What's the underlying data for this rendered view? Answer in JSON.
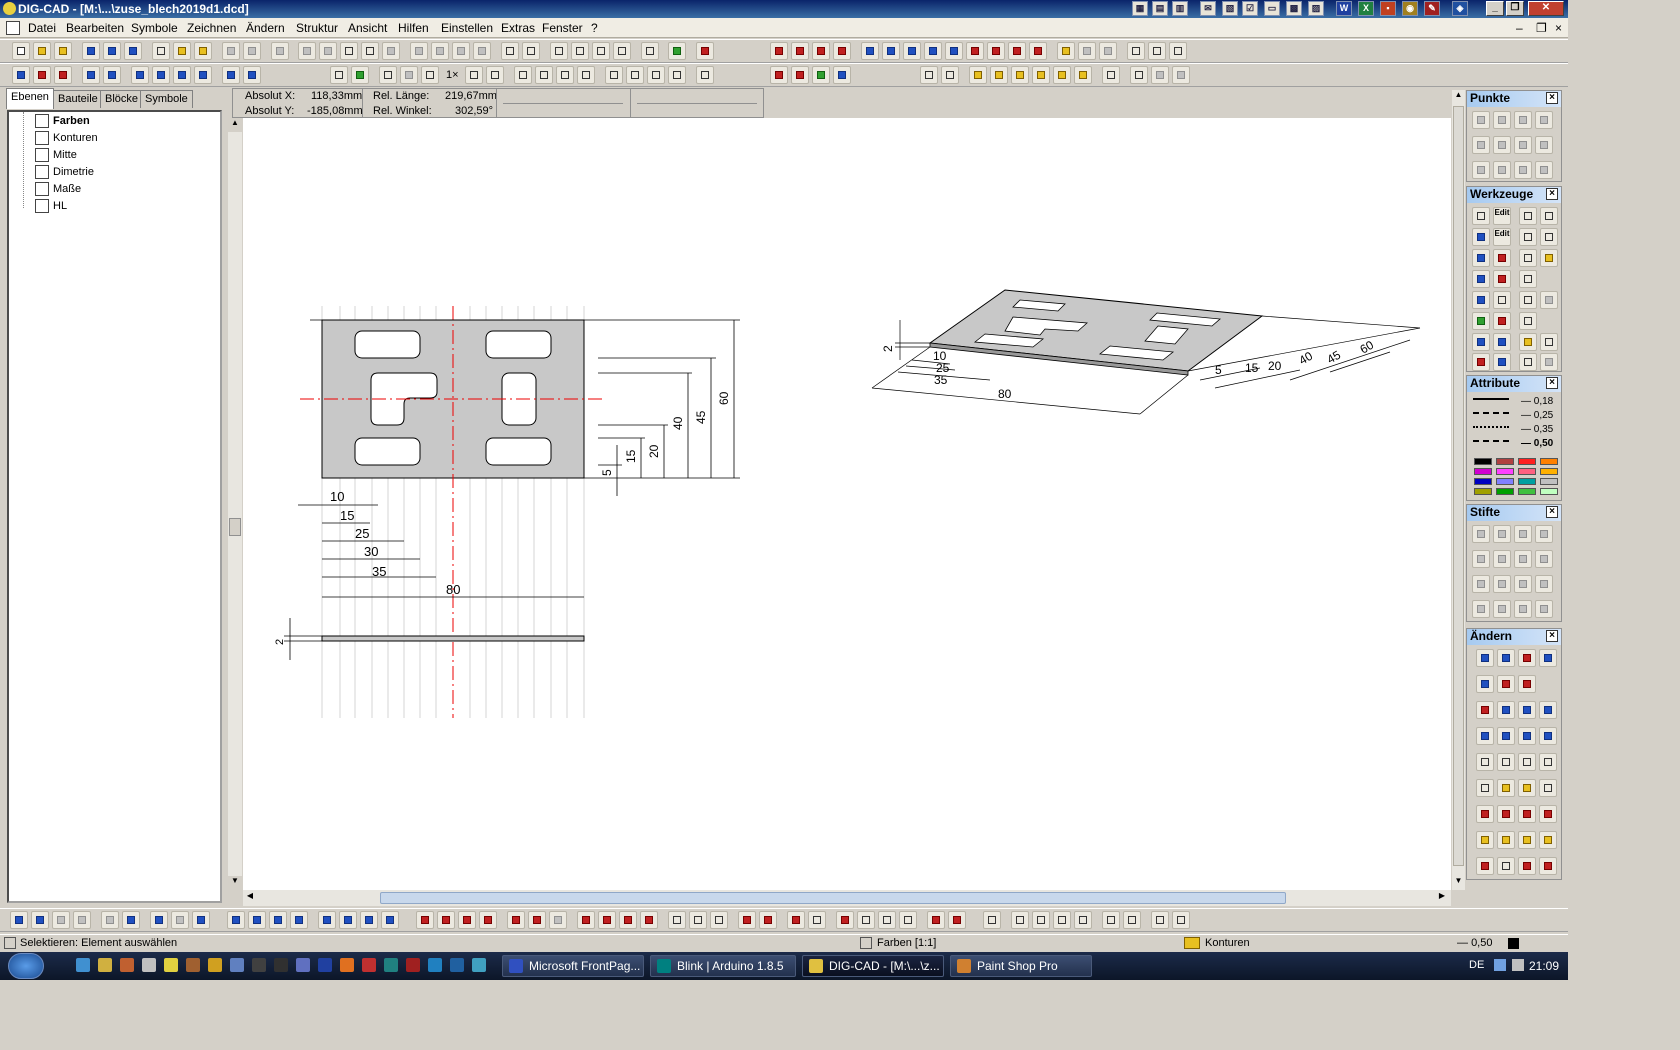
{
  "window": {
    "title": "DIG-CAD - [M:\\...\\zuse_blech2019d1.dcd]",
    "minimize_label": "_",
    "restore_label": "❐",
    "close_label": "✕"
  },
  "menubar": {
    "items": [
      "Datei",
      "Bearbeiten",
      "Symbole",
      "Zeichnen",
      "Ändern",
      "Struktur",
      "Ansicht",
      "Hilfen",
      "Einstellen",
      "Extras",
      "Fenster",
      "?"
    ]
  },
  "left_panel": {
    "tabs": [
      "Ebenen",
      "Bauteile",
      "Blöcke",
      "Symbole"
    ],
    "active_tab": "Ebenen",
    "layers": [
      "Farben",
      "Konturen",
      "Mitte",
      "Dimetrie",
      "Maße",
      "HL"
    ]
  },
  "coordinates": {
    "abs_x_label": "Absolut X:",
    "abs_x_value": "118,33mm",
    "abs_y_label": "Absolut Y:",
    "abs_y_value": "-185,08mm",
    "rel_len_label": "Rel. Länge:",
    "rel_len_value": "219,67mm",
    "rel_angle_label": "Rel. Winkel:",
    "rel_angle_value": "302,59°"
  },
  "drawing": {
    "front_view_dims": [
      "60",
      "45",
      "40",
      "20",
      "15",
      "5"
    ],
    "front_view_bottom_dims": [
      "10",
      "15",
      "25",
      "30",
      "35",
      "80"
    ],
    "side_thickness": "2",
    "iso_dims": [
      "2",
      "10",
      "25",
      "35",
      "80",
      "5",
      "15",
      "20",
      "40",
      "45",
      "60"
    ]
  },
  "right_panels": {
    "punkte": "Punkte",
    "werkzeuge": "Werkzeuge",
    "attribute": "Attribute",
    "stifte": "Stifte",
    "aendern": "Ändern",
    "line_widths": [
      "0,18",
      "0,25",
      "0,35",
      "0,50"
    ],
    "edit_1": "Edit",
    "edit_2": "Edit",
    "colors": [
      "#000000",
      "#b04040",
      "#ff2020",
      "#ff8000",
      "#d000d0",
      "#ff40ff",
      "#ff6080",
      "#ffb000",
      "#0000c0",
      "#8080ff",
      "#00a0a0",
      "#c0c0c0",
      "#a0a000",
      "#00a000",
      "#40c040",
      "#c0ffc0"
    ]
  },
  "toolbar": {
    "scale_label": "1×"
  },
  "status": {
    "left": "Selektieren: Element auswählen",
    "layer": "Farben [1:1]",
    "contour": "Konturen",
    "language": "DE",
    "line_width": "0,50"
  },
  "taskbar": {
    "tasks": [
      "Microsoft FrontPag...",
      "Blink | Arduino 1.8.5",
      "DIG-CAD - [M:\\...\\z...",
      "Paint Shop Pro"
    ],
    "clock": "21:09"
  }
}
